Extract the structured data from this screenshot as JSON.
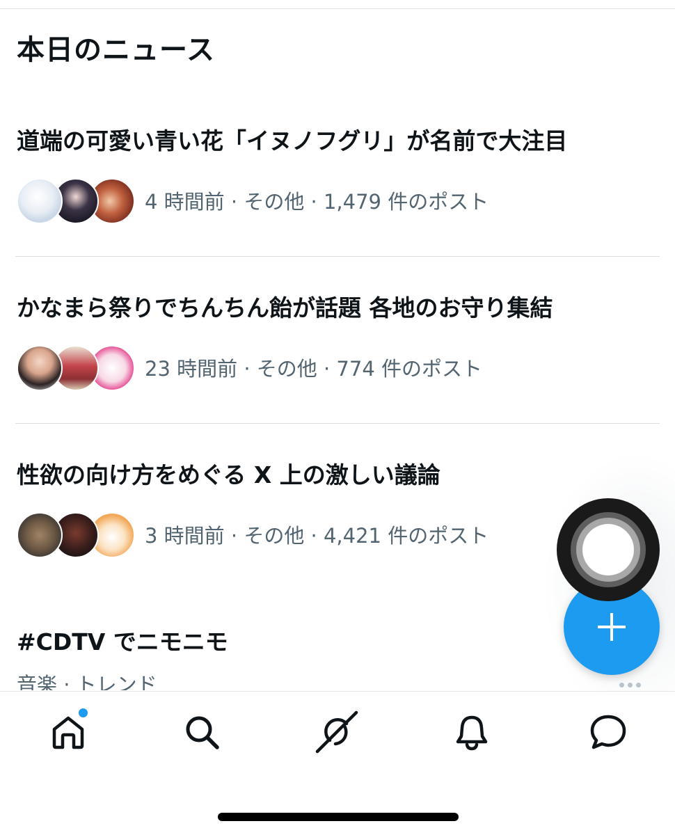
{
  "section": {
    "title": "本日のニュース"
  },
  "news": [
    {
      "headline": "道端の可愛い青い花「イヌノフグリ」が名前で大注目",
      "meta": "4 時間前 · その他 · 1,479 件のポスト"
    },
    {
      "headline": "かなまら祭りでちんちん飴が話題 各地のお守り集結",
      "meta": "23 時間前 · その他 · 774 件のポスト"
    },
    {
      "headline": "性欲の向け方をめぐる X 上の激しい議論",
      "meta": "3 時間前 · その他 · 4,421 件のポスト"
    }
  ],
  "trend": {
    "headline": "#CDTV でニモニモ",
    "meta": "音楽 · トレンド"
  },
  "colors": {
    "accent": "#1d9bf0",
    "secondary_text": "#536471",
    "primary_text": "#0f1419"
  },
  "nav": {
    "items": [
      "home-icon",
      "search-icon",
      "grok-icon",
      "notifications-bell-icon",
      "messages-icon"
    ],
    "home_has_badge": true
  },
  "fab": {
    "icon": "plus-icon"
  }
}
